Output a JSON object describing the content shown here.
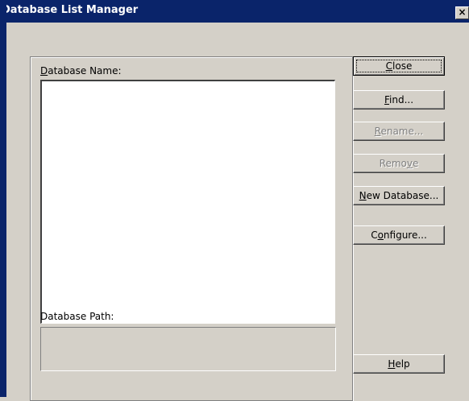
{
  "window": {
    "title": "Database List Manager",
    "close_glyph": "×"
  },
  "labels": {
    "database_name": "Database Name:",
    "database_path": "Database Path:"
  },
  "buttons": {
    "close": "Close",
    "find": "Find...",
    "rename": "Rename...",
    "remove": "Remove",
    "new_database": "New Database...",
    "configure": "Configure...",
    "help": "Help"
  },
  "state": {
    "rename_enabled": false,
    "remove_enabled": false
  },
  "database_list": []
}
